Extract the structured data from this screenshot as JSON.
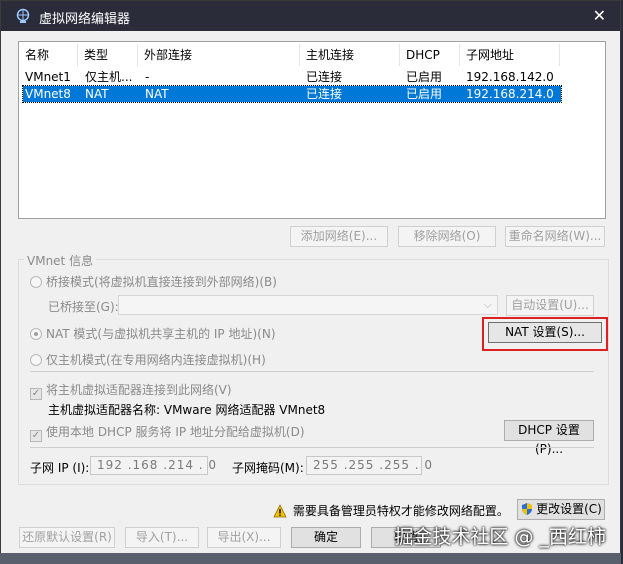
{
  "window": {
    "title": "虚拟网络编辑器"
  },
  "network_list": {
    "columns": [
      "名称",
      "类型",
      "外部连接",
      "主机连接",
      "DHCP",
      "子网地址"
    ],
    "rows": [
      [
        "VMnet1",
        "仅主机...",
        "-",
        "已连接",
        "已启用",
        "192.168.142.0"
      ],
      [
        "VMnet8",
        "NAT",
        "NAT",
        "已连接",
        "已启用",
        "192.168.214.0"
      ]
    ],
    "selected_row": 1
  },
  "list_buttons": {
    "add": "添加网络(E)...",
    "remove": "移除网络(O)",
    "rename": "重命名网络(W)..."
  },
  "vmnet_info": {
    "group_title": "VMnet 信息",
    "bridge_radio": "桥接模式(将虚拟机直接连接到外部网络)(B)",
    "bridged_to_label": "已桥接至(G):",
    "bridged_to_value": "",
    "auto_settings": "自动设置(U)...",
    "nat_radio": "NAT 模式(与虚拟机共享主机的 IP 地址)(N)",
    "nat_settings": "NAT 设置(S)...",
    "host_only_radio": "仅主机模式(在专用网络内连接虚拟机)(H)",
    "connect_adapter_check": "将主机虚拟适配器连接到此网络(V)",
    "adapter_name_line": "主机虚拟适配器名称: VMware 网络适配器 VMnet8",
    "dhcp_check": "使用本地 DHCP 服务将 IP 地址分配给虚拟机(D)",
    "dhcp_settings": "DHCP 设置(P)...",
    "subnet_ip_label": "子网 IP (I):",
    "subnet_ip_value": "192 .168 .214 . 0",
    "subnet_mask_label": "子网掩码(M):",
    "subnet_mask_value": "255 .255 .255 . 0"
  },
  "admin_notice": "需要具备管理员特权才能修改网络配置。",
  "change_settings": "更改设置(C)",
  "footer_buttons": {
    "restore": "还原默认设置(R)",
    "import": "导入(T)...",
    "export": "导出(X)...",
    "ok": "确定",
    "cancel": "取消"
  },
  "watermark": "掘金技术社区 @ _西红柿",
  "colors": {
    "titlebar": "#2a2c39",
    "selection": "#0078d7",
    "highlight_box": "#e02020",
    "dialog_bg": "#f0f0f0"
  },
  "icons": [
    "network-editor-icon",
    "close-icon",
    "warning-icon",
    "shield-icon",
    "chevron-down-icon"
  ]
}
